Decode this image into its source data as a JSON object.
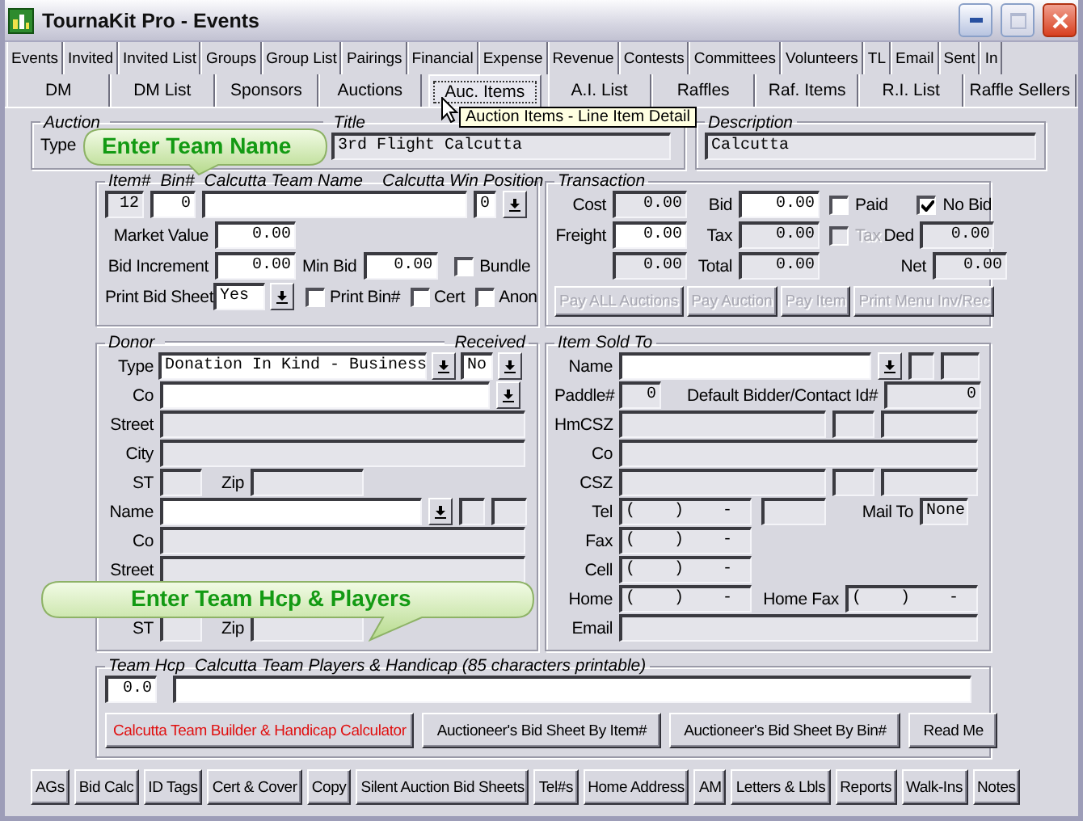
{
  "window": {
    "title": "TournaKit Pro - Events"
  },
  "tabs_row1": [
    {
      "label": "Events",
      "selected": false
    },
    {
      "label": "Invited",
      "selected": false
    },
    {
      "label": "Invited List",
      "selected": false
    },
    {
      "label": "Groups",
      "selected": false
    },
    {
      "label": "Group List",
      "selected": false
    },
    {
      "label": "Pairings",
      "selected": false
    },
    {
      "label": "Financial",
      "selected": false
    },
    {
      "label": "Expense",
      "selected": false
    },
    {
      "label": "Revenue",
      "selected": false
    },
    {
      "label": "Contests",
      "selected": false
    },
    {
      "label": "Committees",
      "selected": false
    },
    {
      "label": "Volunteers",
      "selected": false
    },
    {
      "label": "TL",
      "selected": false
    },
    {
      "label": "Email",
      "selected": false
    },
    {
      "label": "Sent",
      "selected": false
    },
    {
      "label": "In",
      "selected": false
    }
  ],
  "tabs_row2": [
    {
      "label": "DM",
      "selected": false
    },
    {
      "label": "DM List",
      "selected": false
    },
    {
      "label": "Sponsors",
      "selected": false
    },
    {
      "label": "Auctions",
      "selected": false
    },
    {
      "label": "Auc. Items",
      "selected": true
    },
    {
      "label": "A.I. List",
      "selected": false
    },
    {
      "label": "Raffles",
      "selected": false
    },
    {
      "label": "Raf. Items",
      "selected": false
    },
    {
      "label": "R.I. List",
      "selected": false
    },
    {
      "label": "Raffle Sellers",
      "selected": false
    }
  ],
  "tooltip": "Auction Items - Line Item Detail",
  "callouts": [
    "Enter Team Name",
    "Enter Team Hcp & Players"
  ],
  "auction": {
    "legend": "Auction",
    "type": {
      "label": "Type"
    },
    "title": {
      "legend": "Title",
      "value": "3rd Flight Calcutta",
      "editable": false
    },
    "description": {
      "legend": "Description",
      "value": "Calcutta",
      "editable": false
    }
  },
  "item": {
    "headers": {
      "item_no": "Item#",
      "bin_no": "Bin#",
      "team_name": "Calcutta Team Name",
      "win_position": "Calcutta Win Position"
    },
    "item_no": {
      "value": "12",
      "editable": false
    },
    "bin_no": {
      "value": "0",
      "editable": true
    },
    "team_name": {
      "editable": true
    },
    "win_position": {
      "value": "0",
      "editable": true
    },
    "market_value": {
      "label": "Market Value",
      "value": "0.00",
      "editable": true
    },
    "bid_increment": {
      "label": "Bid Increment",
      "value": "0.00",
      "editable": true
    },
    "min_bid": {
      "label": "Min Bid",
      "value": "0.00",
      "editable": true
    },
    "bundle": {
      "label": "Bundle",
      "checked": false
    },
    "print_bid_sheet": {
      "label": "Print Bid Sheet",
      "value": "Yes",
      "editable": true
    },
    "print_bin": {
      "label": "Print Bin#",
      "checked": false
    },
    "cert": {
      "label": "Cert",
      "checked": false
    },
    "anon": {
      "label": "Anon",
      "checked": false
    }
  },
  "transaction": {
    "legend": "Transaction",
    "cost": {
      "label": "Cost",
      "value": "0.00",
      "editable": false
    },
    "bid": {
      "label": "Bid",
      "value": "0.00",
      "editable": true
    },
    "paid": {
      "label": "Paid",
      "checked": false,
      "disabled": false
    },
    "no_bid": {
      "label": "No Bid",
      "checked": true,
      "disabled": false
    },
    "freight": {
      "label": "Freight",
      "value": "0.00",
      "editable": true
    },
    "tax": {
      "label": "Tax",
      "value": "0.00",
      "editable": false
    },
    "tax_ded": {
      "label": "Tax",
      "checked": false,
      "disabled": true
    },
    "ded": {
      "label": "Ded",
      "value": "0.00",
      "editable": false
    },
    "subtotal": {
      "value": "0.00",
      "editable": false
    },
    "total": {
      "label": "Total",
      "value": "0.00",
      "editable": false
    },
    "net": {
      "label": "Net",
      "value": "0.00",
      "editable": false
    },
    "buttons": [
      {
        "label": "Pay ALL Auctions",
        "disabled": true
      },
      {
        "label": "Pay Auction",
        "disabled": true
      },
      {
        "label": "Pay Item",
        "disabled": true
      },
      {
        "label": "Print Menu Inv/Rec",
        "disabled": true
      }
    ]
  },
  "donor": {
    "legend": "Donor",
    "received_legend": "Received",
    "type": {
      "label": "Type",
      "value": "Donation In Kind - Business",
      "editable": true
    },
    "received": {
      "value": "No",
      "editable": true
    },
    "company": {
      "label": "Co",
      "editable": true
    },
    "street": {
      "label": "Street",
      "editable": false
    },
    "city": {
      "label": "City",
      "editable": false
    },
    "st": {
      "label": "ST",
      "editable": false
    },
    "zip": {
      "label": "Zip",
      "editable": false
    },
    "name": {
      "label": "Name",
      "editable": true
    },
    "name_extra": [
      {
        "editable": false
      },
      {
        "editable": false
      }
    ],
    "contact_company": {
      "label": "Co",
      "editable": false
    },
    "contact_street": {
      "label": "Street",
      "editable": false
    },
    "contact_st": {
      "label": "ST",
      "editable": false
    },
    "contact_zip": {
      "label": "Zip",
      "editable": false
    }
  },
  "sold_to": {
    "legend": "Item Sold To",
    "name": {
      "label": "Name",
      "editable": true
    },
    "name_extra": [
      {
        "editable": false
      },
      {
        "editable": false
      }
    ],
    "paddle": {
      "label": "Paddle#",
      "value": "0",
      "editable": false
    },
    "contact_id": {
      "label": "Default Bidder/Contact Id#",
      "value": "0",
      "editable": false
    },
    "home_csz": {
      "label": "HmCSZ",
      "parts": [
        {
          "editable": false
        },
        {
          "editable": false
        },
        {
          "editable": false
        }
      ]
    },
    "company": {
      "label": "Co",
      "editable": false
    },
    "csz": {
      "label": "CSZ",
      "parts": [
        {
          "editable": false
        },
        {
          "editable": false
        },
        {
          "editable": false
        }
      ]
    },
    "tel": {
      "label": "Tel",
      "value": "(    )    -",
      "editable": false
    },
    "tel_ext": {
      "editable": false
    },
    "mail_to": {
      "label": "Mail To",
      "value": "None",
      "editable": false
    },
    "fax": {
      "label": "Fax",
      "value": "(    )    -",
      "editable": false
    },
    "cell": {
      "label": "Cell",
      "value": "(    )    -",
      "editable": false
    },
    "home": {
      "label": "Home",
      "value": "(    )    -",
      "editable": false
    },
    "home_fax": {
      "label": "Home Fax",
      "value": "(    )    -",
      "editable": false
    },
    "email": {
      "label": "Email",
      "editable": false
    }
  },
  "team": {
    "hcp_legend": "Team Hcp",
    "players_legend": "Calcutta Team Players & Handicap (85 characters printable)",
    "hcp": {
      "value": "0.0",
      "editable": true
    },
    "players": {
      "editable": true
    },
    "buttons": [
      {
        "label": "Calcutta Team Builder & Handicap Calculator",
        "kind": "highlight"
      },
      {
        "label": "Auctioneer's Bid Sheet By Item#",
        "kind": "normal"
      },
      {
        "label": "Auctioneer's Bid Sheet By Bin#",
        "kind": "normal"
      },
      {
        "label": "Read Me",
        "kind": "normal"
      }
    ]
  },
  "bottom_buttons": [
    "AGs",
    "Bid Calc",
    "ID Tags",
    "Cert & Cover",
    "Copy",
    "Silent Auction Bid Sheets",
    "Tel#s",
    "Home Address",
    "AM",
    "Letters & Lbls",
    "Reports",
    "Walk-Ins",
    "Notes"
  ]
}
